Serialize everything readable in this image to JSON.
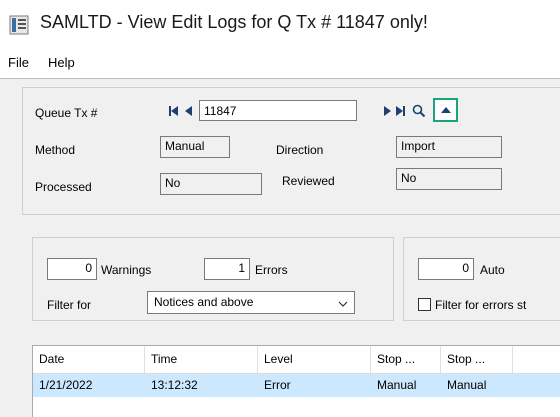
{
  "window": {
    "title": "SAMLTD - View Edit Logs for Q Tx # 11847 only!"
  },
  "menu": [
    "File",
    "Help"
  ],
  "header": {
    "queue_tx_label": "Queue Tx #",
    "queue_tx_value": "11847",
    "method_label": "Method",
    "method_value": "Manual",
    "direction_label": "Direction",
    "direction_value": "Import",
    "processed_label": "Processed",
    "processed_value": "No",
    "reviewed_label": "Reviewed",
    "reviewed_value": "No"
  },
  "filters": {
    "warnings_count": "0",
    "warnings_label": "Warnings",
    "errors_count": "1",
    "errors_label": "Errors",
    "filter_for_label": "Filter for",
    "filter_for_value": "Notices and above",
    "auto_count": "0",
    "auto_label": "Auto",
    "filter_errors_label": "Filter for errors st"
  },
  "grid": {
    "columns": [
      "Date",
      "Time",
      "Level",
      "Stop ...",
      "Stop ..."
    ],
    "rows": [
      [
        "1/21/2022",
        "13:12:32",
        "Error",
        "Manual",
        "Manual"
      ]
    ]
  },
  "icons": {
    "app": "app-icon",
    "first": "first-record-icon",
    "prev": "previous-record-icon",
    "next": "next-record-icon",
    "last": "last-record-icon",
    "search": "search-icon",
    "collapse": "collapse-up-icon"
  },
  "colors": {
    "highlight": "#1ba37a",
    "nav_icon": "#1f3f73",
    "selected_row": "#cce8ff"
  }
}
